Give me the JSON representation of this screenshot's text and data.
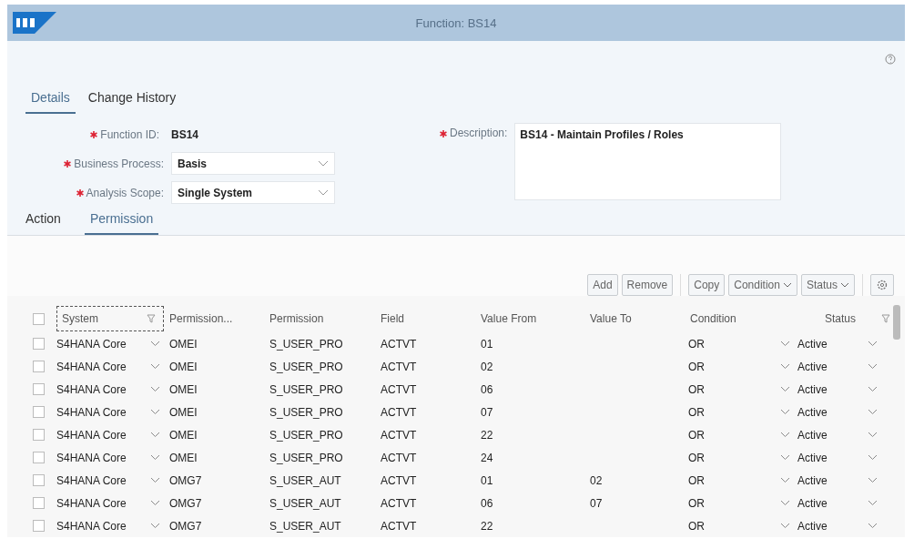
{
  "window": {
    "title": "Function: BS14"
  },
  "tabs": [
    {
      "label": "Details",
      "selected": true
    },
    {
      "label": "Change History",
      "selected": false
    }
  ],
  "form": {
    "function_id": {
      "label": "Function ID:",
      "value": "BS14",
      "required": true
    },
    "business_process": {
      "label": "Business Process:",
      "value": "Basis",
      "required": true
    },
    "analysis_scope": {
      "label": "Analysis Scope:",
      "value": "Single System",
      "required": true
    },
    "description": {
      "label": "Description:",
      "value": "BS14 - Maintain Profiles / Roles",
      "required": true
    }
  },
  "subtabs": [
    {
      "label": "Action",
      "selected": false
    },
    {
      "label": "Permission",
      "selected": true
    }
  ],
  "toolbar": [
    {
      "label": "Add",
      "kind": "button"
    },
    {
      "label": "Remove",
      "kind": "button"
    },
    {
      "label": "Copy",
      "kind": "button"
    },
    {
      "label": "Condition",
      "kind": "menu"
    },
    {
      "label": "Status",
      "kind": "menu"
    }
  ],
  "table": {
    "select_all_checked": false,
    "columns": [
      "System",
      "Permission...",
      "Permission",
      "Field",
      "Value From",
      "Value To",
      "Condition",
      "Status"
    ],
    "rows": [
      {
        "selected": false,
        "system": "S4HANA Core",
        "permission_group": "OMEI",
        "permission": "S_USER_PRO",
        "field": "ACTVT",
        "value_from": "01",
        "condition": "OR",
        "status": "Active"
      },
      {
        "selected": false,
        "system": "S4HANA Core",
        "permission_group": "OMEI",
        "permission": "S_USER_PRO",
        "field": "ACTVT",
        "value_from": "02",
        "condition": "OR",
        "status": "Active"
      },
      {
        "selected": false,
        "system": "S4HANA Core",
        "permission_group": "OMEI",
        "permission": "S_USER_PRO",
        "field": "ACTVT",
        "value_from": "06",
        "condition": "OR",
        "status": "Active"
      },
      {
        "selected": false,
        "system": "S4HANA Core",
        "permission_group": "OMEI",
        "permission": "S_USER_PRO",
        "field": "ACTVT",
        "value_from": "07",
        "condition": "OR",
        "status": "Active"
      },
      {
        "selected": false,
        "system": "S4HANA Core",
        "permission_group": "OMEI",
        "permission": "S_USER_PRO",
        "field": "ACTVT",
        "value_from": "22",
        "condition": "OR",
        "status": "Active"
      },
      {
        "selected": false,
        "system": "S4HANA Core",
        "permission_group": "OMEI",
        "permission": "S_USER_PRO",
        "field": "ACTVT",
        "value_from": "24",
        "condition": "OR",
        "status": "Active"
      },
      {
        "selected": false,
        "system": "S4HANA Core",
        "permission_group": "OMG7",
        "permission": "S_USER_AUT",
        "field": "ACTVT",
        "value_from": "01",
        "value_to": "02",
        "condition": "OR",
        "status": "Active"
      },
      {
        "selected": false,
        "system": "S4HANA Core",
        "permission_group": "OMG7",
        "permission": "S_USER_AUT",
        "field": "ACTVT",
        "value_from": "06",
        "value_to": "07",
        "condition": "OR",
        "status": "Active"
      },
      {
        "selected": false,
        "system": "S4HANA Core",
        "permission_group": "OMG7",
        "permission": "S_USER_AUT",
        "field": "ACTVT",
        "value_from": "22",
        "condition": "OR",
        "status": "Active"
      }
    ]
  }
}
